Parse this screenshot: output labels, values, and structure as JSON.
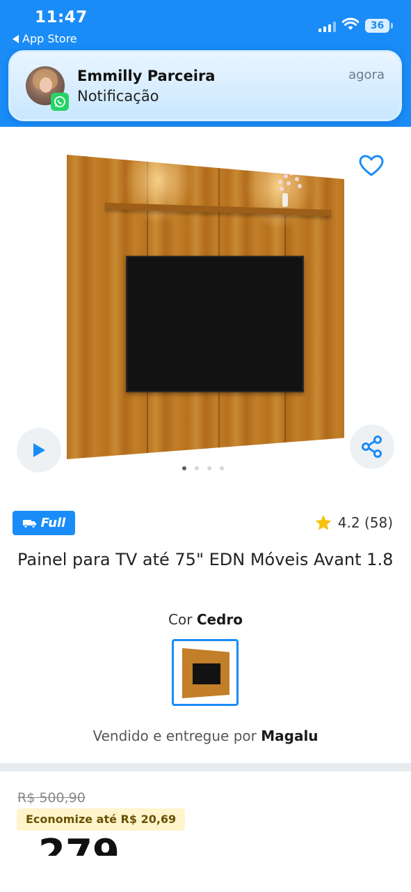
{
  "status_bar": {
    "time": "11:47",
    "back_label": "App Store",
    "battery": "36",
    "accent": "#1a8cf7"
  },
  "notification": {
    "app_icon": "whatsapp-icon",
    "title": "Emmilly Parceira",
    "body": "Notificação",
    "time": "agora"
  },
  "gallery": {
    "current_image": 1,
    "image_count": 4,
    "icons": [
      "heart-icon",
      "play-icon",
      "share-icon"
    ]
  },
  "product": {
    "badge": "Full",
    "rating": "4.2 (58)",
    "title": "Painel para TV até 75\" EDN Móveis Avant 1.8",
    "color_label": "Cor",
    "color_value": "Cedro",
    "sold_by_prefix": "Vendido e entregue por",
    "seller": "Magalu"
  },
  "price": {
    "old": "R$ 500,90",
    "saving": "Economize até R$ 20,69",
    "current_partial": "279"
  }
}
